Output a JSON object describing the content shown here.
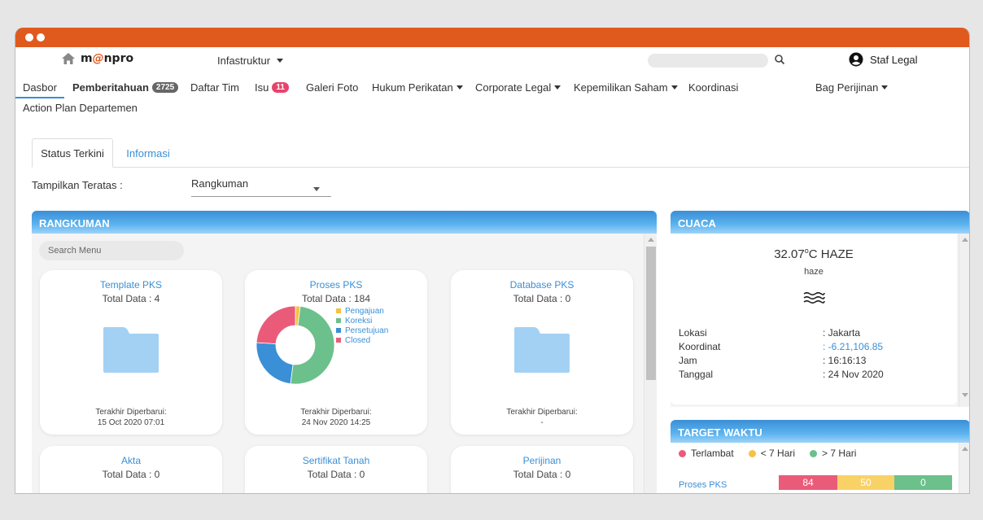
{
  "app": {
    "logo_text_left": "m",
    "logo_text_at": "@",
    "logo_text_right": "npro",
    "project_selector": "Infastruktur",
    "user_name": "Staf Legal"
  },
  "search": {
    "placeholder": ""
  },
  "nav": {
    "items": [
      {
        "label": "Dasbor"
      },
      {
        "label": "Pemberitahuan",
        "badge": "2725"
      },
      {
        "label": "Daftar Tim"
      },
      {
        "label": "Isu",
        "badge": "11"
      },
      {
        "label": "Galeri Foto"
      },
      {
        "label": "Hukum Perikatan"
      },
      {
        "label": "Corporate Legal"
      },
      {
        "label": "Kepemilikan Saham"
      },
      {
        "label": "Koordinasi"
      },
      {
        "label": "Bag Perijinan"
      },
      {
        "label": "Action Plan Departemen"
      }
    ]
  },
  "tabs": [
    {
      "label": "Status Terkini"
    },
    {
      "label": "Informasi"
    }
  ],
  "filter": {
    "label": "Tampilkan Teratas :",
    "value": "Rangkuman"
  },
  "rangkuman": {
    "title": "RANGKUMAN",
    "search_placeholder": "Search Menu",
    "cards": [
      {
        "title": "Template PKS",
        "total": "Total Data : 4",
        "updated_label": "Terakhir Diperbarui:",
        "updated": "15 Oct 2020 07:01"
      },
      {
        "title": "Proses PKS",
        "total": "Total Data : 184",
        "updated_label": "Terakhir Diperbarui:",
        "updated": "24 Nov 2020 14:25"
      },
      {
        "title": "Database PKS",
        "total": "Total Data : 0",
        "updated_label": "Terakhir Diperbarui:",
        "updated": "-"
      },
      {
        "title": "Akta",
        "total": "Total Data : 0"
      },
      {
        "title": "Sertifikat Tanah",
        "total": "Total Data : 0"
      },
      {
        "title": "Perijinan",
        "total": "Total Data : 0"
      }
    ]
  },
  "chart_data": {
    "type": "pie",
    "categories": [
      "Pengajuan",
      "Koreksi",
      "Persetujuan",
      "Closed"
    ],
    "values": [
      2,
      50,
      24,
      24
    ],
    "colors": [
      "#f5c243",
      "#6cc08b",
      "#3a8fd6",
      "#ea5b7a"
    ],
    "legend_placement": "right"
  },
  "cuaca": {
    "title": "CUACA",
    "temp": "32.07",
    "unit_deg": "o",
    "unit_rest": "C HAZE",
    "desc": "haze",
    "icon": "haze-icon",
    "rows": [
      {
        "label": "Lokasi",
        "value": ": Jakarta"
      },
      {
        "label": "Koordinat",
        "value": ": -6.21,106.85"
      },
      {
        "label": "Jam",
        "value": ": 16:16:13"
      },
      {
        "label": "Tanggal",
        "value": ": 24 Nov 2020"
      }
    ]
  },
  "target_waktu": {
    "title": "TARGET WAKTU",
    "legend": [
      {
        "label": "Terlambat",
        "color": "#ea5b7a"
      },
      {
        "label": "< 7 Hari",
        "color": "#f5c243"
      },
      {
        "label": "> 7 Hari",
        "color": "#6cc08b"
      }
    ],
    "rows": [
      {
        "label": "Proses PKS",
        "values": [
          "84",
          "50",
          "0"
        ]
      }
    ]
  }
}
